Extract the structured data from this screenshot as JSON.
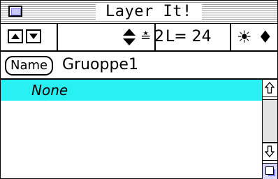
{
  "window": {
    "title": "Layer It!"
  },
  "toolbar": {
    "layer_count": "2",
    "l_value": "L= 24"
  },
  "name_row": {
    "button_label": "Name",
    "value": "Gruoppe1"
  },
  "list": {
    "items": [
      {
        "label": "None",
        "selected": true
      }
    ]
  },
  "colors": {
    "selection": "#2af1f1",
    "scroll_track": "#e3e3e3"
  },
  "icons": [
    "close-box",
    "arrow-up",
    "arrow-down",
    "layer-stepper",
    "bulb",
    "pin"
  ]
}
